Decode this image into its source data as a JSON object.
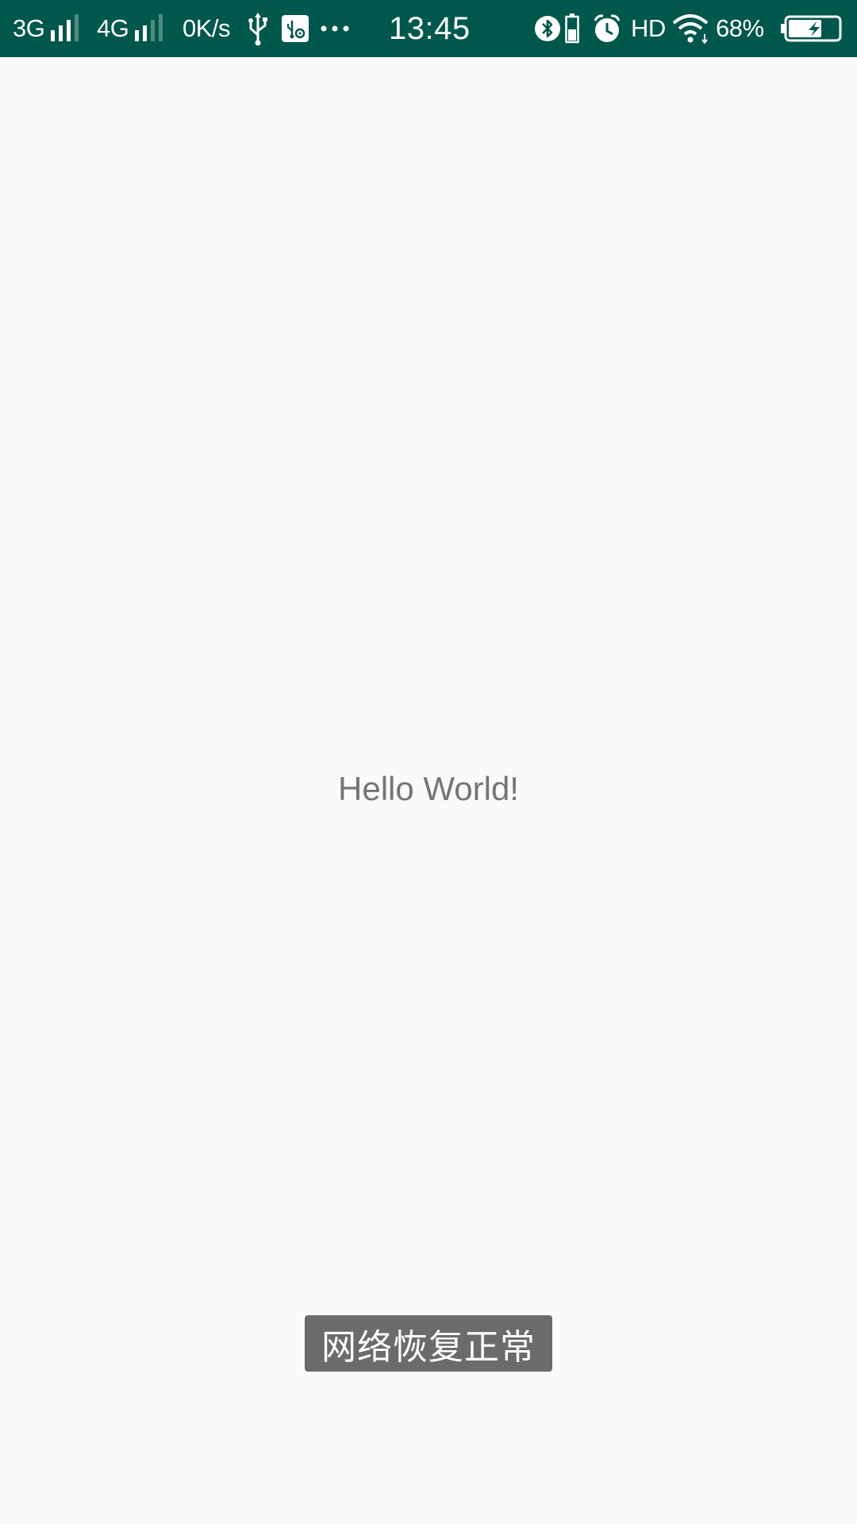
{
  "colors": {
    "status_bar_bg": "#00574b",
    "background": "#fafafa",
    "hello_text": "#757575",
    "toast_bg": "#6b6b6b"
  },
  "status_bar": {
    "sim1_network": "3G",
    "sim2_network": "4G",
    "net_speed": "0K/s",
    "time": "13:45",
    "hd_label": "HD",
    "battery_percent": "68%",
    "battery_level": 0.68,
    "icons": [
      "signal-sim1-icon",
      "signal-sim2-icon",
      "usb-icon",
      "usb-debugging-icon",
      "more-notifications-icon",
      "bluetooth-icon",
      "phone-battery-icon",
      "alarm-icon",
      "wifi-icon",
      "battery-charging-icon"
    ]
  },
  "main": {
    "hello_text": "Hello World!"
  },
  "toast": {
    "message": "网络恢复正常"
  }
}
